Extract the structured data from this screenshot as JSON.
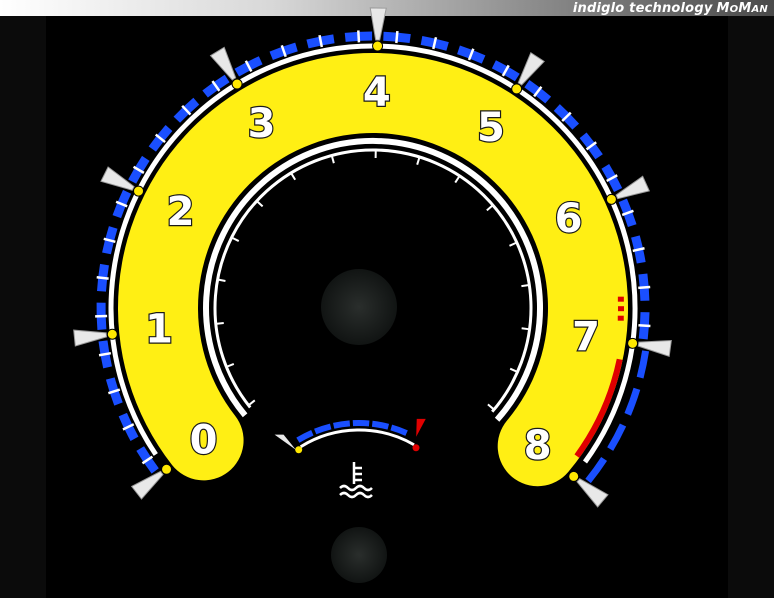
{
  "banner": {
    "tech_text": "indiglo technology",
    "brand_first": "M",
    "brand_mid_small": "O",
    "brand_m": "M",
    "brand_end_small": "AN"
  },
  "gauge": {
    "labels": [
      "0",
      "1",
      "2",
      "3",
      "4",
      "5",
      "6",
      "7",
      "8"
    ],
    "colors": {
      "face": "#ffef14",
      "ticks_blue": "#1a4fff",
      "redline": "#e00000",
      "rim": "#ffffff",
      "dot": "#ffe800"
    },
    "redline_start": 7,
    "redline_end": 8
  },
  "temp_gauge": {
    "icon": "coolant-temperature-icon"
  }
}
